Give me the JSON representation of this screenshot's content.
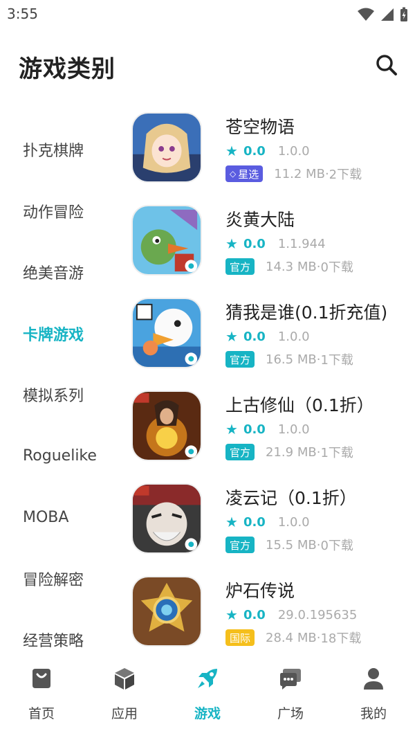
{
  "status_bar": {
    "time": "3:55"
  },
  "header": {
    "title": "游戏类别",
    "search_icon": "search-icon"
  },
  "sidebar": {
    "categories": [
      {
        "label": "扑克棋牌",
        "active": false
      },
      {
        "label": "动作冒险",
        "active": false
      },
      {
        "label": "绝美音游",
        "active": false
      },
      {
        "label": "卡牌游戏",
        "active": true
      },
      {
        "label": "模拟系列",
        "active": false
      },
      {
        "label": "Roguelike",
        "active": false
      },
      {
        "label": "MOBA",
        "active": false
      },
      {
        "label": "冒险解密",
        "active": false
      },
      {
        "label": "经营策略",
        "active": false
      }
    ]
  },
  "games": [
    {
      "name": "苍空物语",
      "score": "0.0",
      "version": "1.0.0",
      "badge": "星选",
      "badge_type": "select",
      "size": "11.2 MB",
      "downloads": "2下载"
    },
    {
      "name": "炎黄大陆",
      "score": "0.0",
      "version": "1.1.944",
      "badge": "官方",
      "badge_type": "official",
      "size": "14.3 MB",
      "downloads": "0下载"
    },
    {
      "name": "猜我是谁(0.1折充值)",
      "score": "0.0",
      "version": "1.0.0",
      "badge": "官方",
      "badge_type": "official",
      "size": "16.5 MB",
      "downloads": "1下载"
    },
    {
      "name": "上古修仙（0.1折）",
      "score": "0.0",
      "version": "1.0.0",
      "badge": "官方",
      "badge_type": "official",
      "size": "21.9 MB",
      "downloads": "1下载"
    },
    {
      "name": "凌云记（0.1折）",
      "score": "0.0",
      "version": "1.0.0",
      "badge": "官方",
      "badge_type": "official",
      "size": "15.5 MB",
      "downloads": "0下载"
    },
    {
      "name": "炉石传说",
      "score": "0.0",
      "version": "29.0.195635",
      "badge": "国际",
      "badge_type": "intl",
      "size": "28.4 MB",
      "downloads": "18下载"
    }
  ],
  "separator": " · ",
  "bottom_nav": {
    "items": [
      {
        "label": "首页",
        "icon": "shop-bag-icon",
        "active": false
      },
      {
        "label": "应用",
        "icon": "cube-icon",
        "active": false
      },
      {
        "label": "游戏",
        "icon": "rocket-icon",
        "active": true
      },
      {
        "label": "广场",
        "icon": "chat-bubbles-icon",
        "active": false
      },
      {
        "label": "我的",
        "icon": "person-icon",
        "active": false
      }
    ]
  },
  "colors": {
    "accent": "#17b4c4",
    "badge_official": "#17b4c4",
    "badge_intl": "#f5bf1c",
    "badge_select": "#5a5ce0"
  }
}
